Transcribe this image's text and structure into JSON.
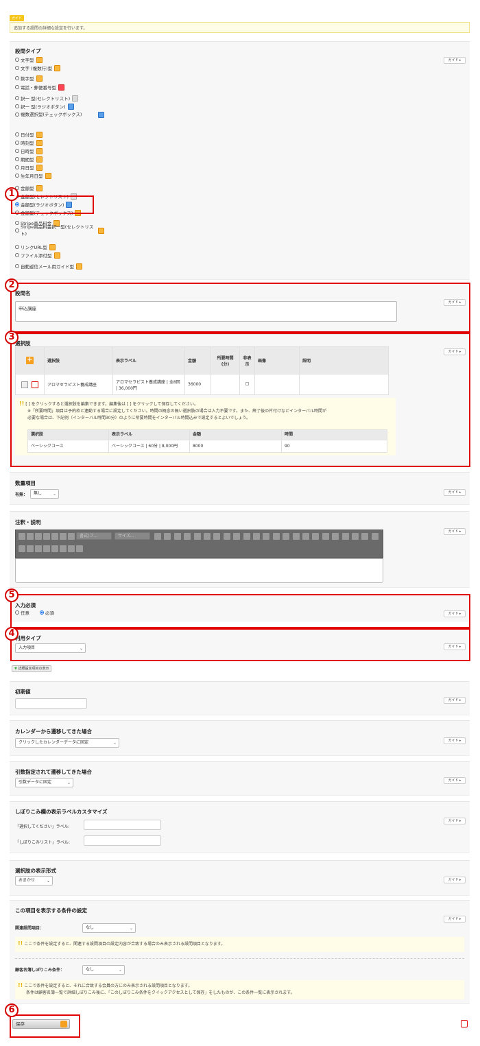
{
  "guide": {
    "tag": "ガイド",
    "text": "追加する設問の詳細な設定を行います。"
  },
  "guide_button": "ガイド",
  "question_type": {
    "title": "設問タイプ",
    "items": [
      {
        "label": "文字型",
        "checked": false
      },
      {
        "label": "文字 (複数行)型",
        "checked": false
      },
      {
        "label": "数字型",
        "checked": false
      },
      {
        "label": "電話・郵便番号型",
        "checked": false
      },
      {
        "label": "択一 型(セレクトリスト)",
        "checked": false
      },
      {
        "label": "択一 型(ラジオボタン)",
        "checked": false
      },
      {
        "label": "複数選択型(チェックボックス)",
        "checked": false
      },
      {
        "label": "日付型",
        "checked": false
      },
      {
        "label": "時刻型",
        "checked": false
      },
      {
        "label": "日時型",
        "checked": false
      },
      {
        "label": "期間型",
        "checked": false
      },
      {
        "label": "月日型",
        "checked": false
      },
      {
        "label": "生年月日型",
        "checked": false
      },
      {
        "label": "金額型",
        "checked": false
      },
      {
        "label": "金額型(セレクトリスト)",
        "checked": false
      },
      {
        "label": "金額型(ラジオボタン)",
        "checked": true
      },
      {
        "label": "金額型(チェックボックス)",
        "checked": false
      },
      {
        "label": "Stripe商品料金",
        "checked": false
      },
      {
        "label": "Stripe商品料金択一型(セレクトリスト)",
        "checked": false
      },
      {
        "label": "リンクURL型",
        "checked": false
      },
      {
        "label": "ファイル添付型",
        "checked": false
      },
      {
        "label": "自動返信メール用ガイド型",
        "checked": false
      }
    ]
  },
  "question_name": {
    "title": "設問名",
    "value": "申込講座"
  },
  "choices": {
    "title": "選択肢",
    "headers": [
      "選択肢",
      "表示ラベル",
      "金額",
      "所要時間(分)",
      "非表示",
      "画像",
      "説明"
    ],
    "rows": [
      {
        "choice": "アロマセラピスト養成講座",
        "label": "アロマセラピスト養成講座 | 全8回 | 36,000円",
        "amount": "36000"
      }
    ],
    "note_line1": "[ ] をクリックすると選択肢を編集できます。編集後は [ ] をクリックして保存してください。",
    "note_line2": "※「所要時間」項目は予約枠と連動する場合に設定してください。時間の概念の無い選択肢の場合は入力不要です。また、終了後の片付けなどインターバル時間が",
    "note_line3": "必要な場合は、下記例（インターバル時間30分）のように所要時間をインターバル時間込みで設定するとよいでしょう。",
    "example_headers": [
      "選択肢",
      "表示ラベル",
      "金額",
      "時間"
    ],
    "example_row": [
      "ベーシックコース",
      "ベーシックコース | 60分 | 8,000円",
      "8000",
      "90"
    ]
  },
  "quantity": {
    "title": "数量項目",
    "label": "有無：",
    "value": "無し"
  },
  "notes": {
    "title": "注釈・説明",
    "font_placeholder": "書式(フ...",
    "size_placeholder": "サイズ..."
  },
  "required": {
    "title": "入力必須",
    "options": [
      "任意",
      "必須"
    ],
    "selected": "必須"
  },
  "usage_type": {
    "title": "利用タイプ",
    "value": "入力項目"
  },
  "show_advanced": "詳細設定項目の表示",
  "initial_value": {
    "title": "初期値"
  },
  "calendar": {
    "title": "カレンダーから遷移してきた場合",
    "value": "クリックしたカレンダーデータに固定"
  },
  "argument": {
    "title": "引数指定されて遷移してきた場合",
    "value": "引数データに固定"
  },
  "filter_labels": {
    "title": "しぼりこみ欄の表示ラベルカスタマイズ",
    "label1": "「選択してください」ラベル:",
    "label2": "「しぼりこみリスト」ラベル:"
  },
  "display_format": {
    "title": "選択肢の表示形式",
    "value": "おまかせ"
  },
  "condition": {
    "title": "この項目を表示する条件の設定",
    "related_label": "関連設問項目：",
    "related_value": "なし",
    "related_note": "ここで条件を設定すると、関連する設問項目の設定内容が合致する場合のみ表示される設問項目となります。",
    "customer_label": "顧客名簿しぼりこみ条件：",
    "customer_value": "なし",
    "customer_note1": "ここで条件を設定すると、それに合致する会員の方にのみ表示される設問項目となります。",
    "customer_note2": "条件は顧客名簿一覧で詳細しぼりこみ後に、「このしぼりこみ条件をクイックアクセスとして保存」をしたものが、この条件一覧に表示されます。"
  },
  "save_label": "保存",
  "callouts": [
    "1",
    "2",
    "3",
    "4",
    "5",
    "6"
  ]
}
